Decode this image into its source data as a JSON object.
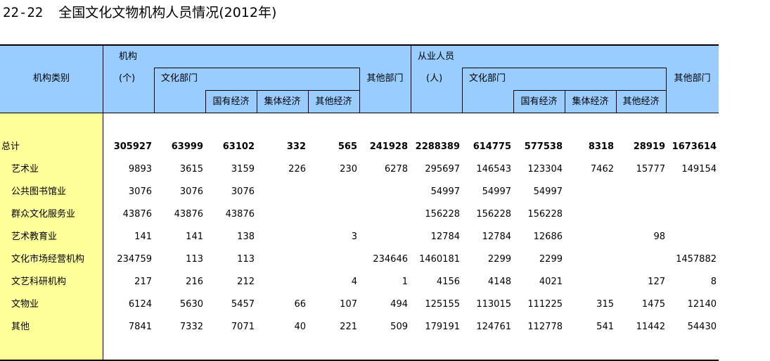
{
  "title": {
    "number": "22-22",
    "text": "全国文化文物机构人员情况(2012年)"
  },
  "header": {
    "stub": "机构类别",
    "institutions": "机构",
    "institutions_unit": "(个)",
    "employees": "从业人员",
    "employees_unit": "(人)",
    "culture_dept": "文化部门",
    "other_dept": "其他部门",
    "state_owned": "国有经济",
    "collective": "集体经济",
    "other_economy": "其他经济"
  },
  "rows": [
    {
      "name": "总计",
      "values": [
        "305927",
        "63999",
        "63102",
        "332",
        "565",
        "241928",
        "2288389",
        "614775",
        "577538",
        "8318",
        "28919",
        "1673614"
      ]
    },
    {
      "name": "艺术业",
      "values": [
        "9893",
        "3615",
        "3159",
        "226",
        "230",
        "6278",
        "295697",
        "146543",
        "123304",
        "7462",
        "15777",
        "149154"
      ]
    },
    {
      "name": "公共图书馆业",
      "values": [
        "3076",
        "3076",
        "3076",
        "",
        "",
        "",
        "54997",
        "54997",
        "54997",
        "",
        "",
        ""
      ]
    },
    {
      "name": "群众文化服务业",
      "values": [
        "43876",
        "43876",
        "43876",
        "",
        "",
        "",
        "156228",
        "156228",
        "156228",
        "",
        "",
        ""
      ]
    },
    {
      "name": "艺术教育业",
      "values": [
        "141",
        "141",
        "138",
        "",
        "3",
        "",
        "12784",
        "12784",
        "12686",
        "",
        "98",
        ""
      ]
    },
    {
      "name": "文化市场经营机构",
      "values": [
        "234759",
        "113",
        "113",
        "",
        "",
        "234646",
        "1460181",
        "2299",
        "2299",
        "",
        "",
        "1457882"
      ]
    },
    {
      "name": "文艺科研机构",
      "values": [
        "217",
        "216",
        "212",
        "",
        "4",
        "1",
        "4156",
        "4148",
        "4021",
        "",
        "127",
        "8"
      ]
    },
    {
      "name": "文物业",
      "values": [
        "6124",
        "5630",
        "5457",
        "66",
        "107",
        "494",
        "125155",
        "113015",
        "111225",
        "315",
        "1475",
        "12140"
      ]
    },
    {
      "name": "其他",
      "values": [
        "7841",
        "7332",
        "7071",
        "40",
        "221",
        "509",
        "179191",
        "124761",
        "112778",
        "541",
        "11442",
        "54430"
      ]
    }
  ]
}
